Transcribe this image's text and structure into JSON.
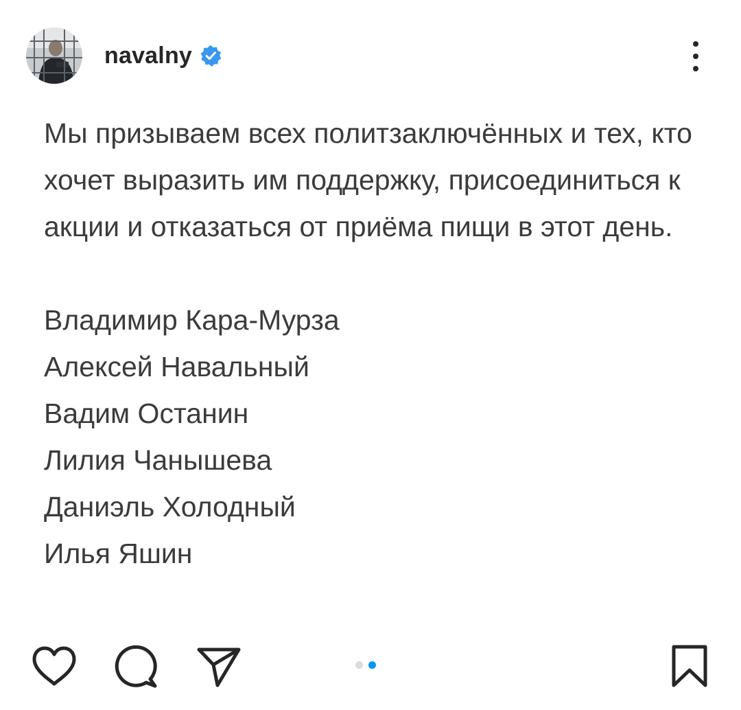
{
  "header": {
    "username": "navalny",
    "verified": true,
    "avatar_icon": "profile-photo",
    "more_icon": "more-vertical-icon"
  },
  "caption": {
    "text": "Мы призываем всех политзаключённых и тех, кто хочет выразить им поддержку, присоединиться к акции и отказаться от приёма пищи в этот день.",
    "lines": [
      "Мы призываем всех политзаключённых и",
      "тех, кто хочет выразить им поддержку,",
      "присоединиться к акции и отказаться от",
      "приёма пищи в этот день."
    ],
    "names": [
      "Владимир Кара-Мурза",
      "Алексей Навальный",
      "Вадим Останин",
      "Лилия Чанышева",
      "Даниэль Холодный",
      "Илья Яшин"
    ]
  },
  "actions": {
    "like_icon": "heart-icon",
    "comment_icon": "comment-icon",
    "share_icon": "send-icon",
    "save_icon": "bookmark-icon"
  },
  "carousel": {
    "total": 2,
    "active_index": 1,
    "active_color": "#0095f6",
    "inactive_color": "#dbdbdb"
  },
  "colors": {
    "verified_badge": "#3897f0",
    "text": "#262626"
  }
}
